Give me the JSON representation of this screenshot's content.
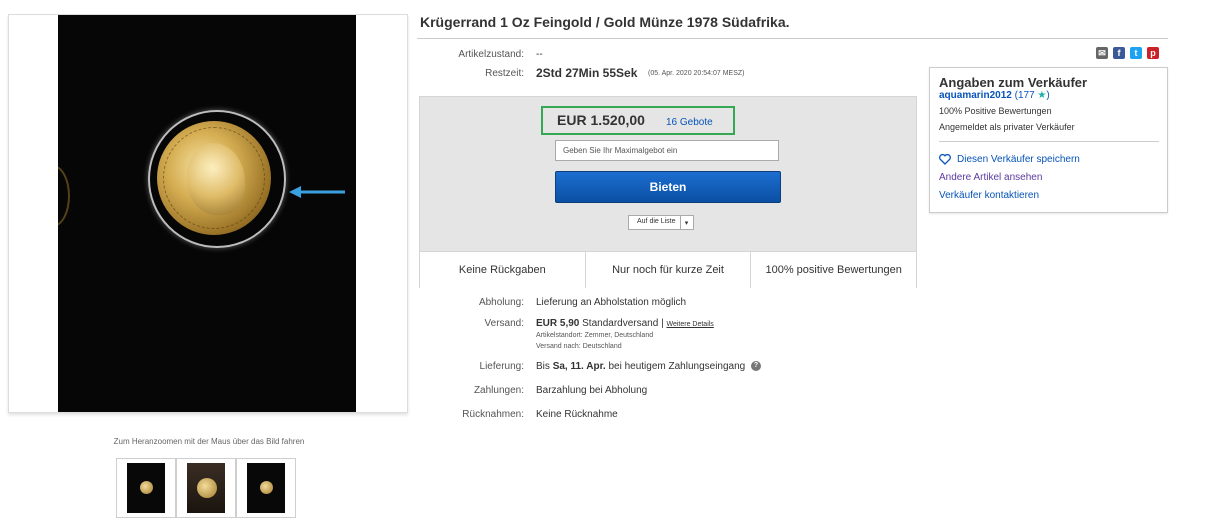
{
  "listing": {
    "title": "Krügerrand 1 Oz Feingold / Gold Münze 1978 Südafrika.",
    "zoom_hint": "Zum Heranzoomen mit der Maus über das Bild fahren",
    "thumbnails": [
      "coin-photo-1",
      "coin-photo-2",
      "coin-photo-3"
    ]
  },
  "details": {
    "condition_label": "Artikelzustand:",
    "condition_value": "--",
    "time_label": "Restzeit:",
    "time_value": "2Std 27Min 55Sek",
    "time_detail": "(05. Apr. 2020   20:54:07 MESZ)"
  },
  "share": {
    "icons": [
      "email-icon",
      "facebook-icon",
      "twitter-icon",
      "pinterest-icon"
    ],
    "colors": {
      "email": "#666666",
      "facebook": "#3b5998",
      "twitter": "#1da1f2",
      "pinterest": "#cb2027"
    }
  },
  "bid": {
    "price": "EUR 1.520,00",
    "bid_count": "16 Gebote",
    "max_bid_placeholder": "Geben Sie Ihr Maximalgebot ein",
    "bid_button": "Bieten",
    "watchlist_label": "Auf die Liste",
    "watchlist_arrow": "▾",
    "highlight_color": "#34a853",
    "features": [
      "Keine Rückgaben",
      "Nur noch für kurze Zeit",
      "100% positive Bewertungen"
    ]
  },
  "shipping": {
    "pickup_label": "Abholung:",
    "pickup_value": "Lieferung an Abholstation möglich",
    "shipping_label": "Versand:",
    "shipping_amount": "EUR 5,90",
    "shipping_method": "Standardversand |",
    "shipping_link": "Weitere Details",
    "location": "Artikelstandort:  Zemmer, Deutschland",
    "ship_to": "Versand nach:  Deutschland",
    "delivery_label": "Lieferung:",
    "delivery_prefix": "Bis",
    "delivery_date": "Sa, 11. Apr.",
    "delivery_suffix": "bei heutigem Zahlungseingang",
    "payment_label": "Zahlungen:",
    "payment_value": "Barzahlung bei Abholung",
    "returns_label": "Rücknahmen:",
    "returns_value": "Keine Rücknahme"
  },
  "seller": {
    "heading": "Angaben zum Verkäufer",
    "name": "aquamarin2012",
    "score": "(177",
    "score_close": ")",
    "feedback": "100% Positive Bewertungen",
    "account_type": "Angemeldet als privater Verkäufer",
    "save_seller": "Diesen Verkäufer speichern",
    "other_items": "Andere Artikel ansehen",
    "contact": "Verkäufer kontaktieren"
  }
}
